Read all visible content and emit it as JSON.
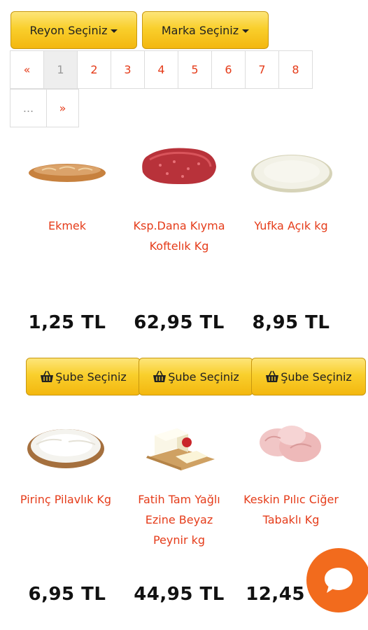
{
  "filters": {
    "reyon_label": "Reyon Seçiniz",
    "marka_label": "Marka Seçiniz"
  },
  "pagination": {
    "prev": "«",
    "pages": [
      "1",
      "2",
      "3",
      "4",
      "5",
      "6",
      "7",
      "8"
    ],
    "current": "1",
    "ellipsis": "...",
    "next": "»"
  },
  "branch_button_label": "Şube Seçiniz",
  "products": [
    {
      "name": "Ekmek",
      "price": "1,25 TL"
    },
    {
      "name": "Ksp.Dana Kıyma Koftelık Kg",
      "price": "62,95 TL"
    },
    {
      "name": "Yufka Açık kg",
      "price": "8,95 TL"
    },
    {
      "name": "Pirinç Pilavlık Kg",
      "price": "6,95 TL"
    },
    {
      "name": "Fatih Tam Yağlı Ezine Beyaz Peynir kg",
      "price": "44,95 TL"
    },
    {
      "name": "Keskin Pılıc Ciğer Tabaklı Kg",
      "price": "12,45 TL"
    }
  ],
  "colors": {
    "accent_red": "#e53c1a",
    "button_yellow": "#f9cf2c",
    "chat_orange": "#f26b1d"
  },
  "icons": {
    "branch_button": "basket-icon",
    "chat": "chat-bubble-icon"
  }
}
